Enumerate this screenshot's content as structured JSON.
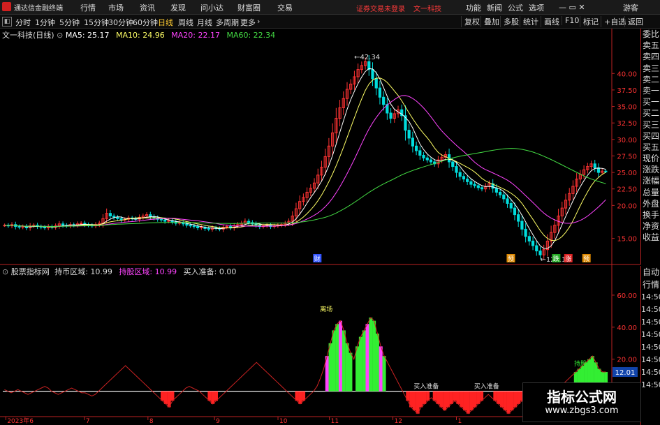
{
  "app": {
    "title": "通达信金融终端"
  },
  "menu": {
    "items": [
      "行情",
      "市场",
      "资讯",
      "发现",
      "问小达",
      "财富圈",
      "交易"
    ],
    "notice": "证券交易未登录",
    "stock_tab": "文一科技",
    "right": [
      "功能",
      "新闻",
      "公式",
      "选项"
    ],
    "user": "游客"
  },
  "periods": {
    "items": [
      "分时",
      "1分钟",
      "5分钟",
      "15分钟",
      "30分钟",
      "60分钟",
      "日线",
      "周线",
      "月线",
      "多周期",
      "更多"
    ],
    "active": "日线"
  },
  "tools": {
    "items": [
      "复权",
      "叠加",
      "多股",
      "统计",
      "画线",
      "F10",
      "标记",
      "+自选",
      "返回"
    ]
  },
  "main_legend": {
    "title": "文一科技(日线)",
    "ma5": "MA5: 25.17",
    "ma10": "MA10: 24.96",
    "ma20": "MA20: 22.17",
    "ma60": "MA60: 22.34"
  },
  "ind_legend": {
    "name": "股票指标网",
    "hold": "持币区域: 10.99",
    "hold_stock": "持股区域: 10.99",
    "buy": "买入准备: 0.00"
  },
  "colors": {
    "ma5": "#ffffff",
    "ma10": "#ffff66",
    "ma20": "#ff44ff",
    "ma60": "#44dd44",
    "up": "#ff3333",
    "down": "#00dddd"
  },
  "right_panel": {
    "top": [
      "委比",
      "卖五",
      "卖四",
      "卖三",
      "卖二",
      "卖一",
      "买一",
      "买二",
      "买三",
      "买四",
      "买五",
      "现价",
      "涨跌",
      "涨幅",
      "总量",
      "外盘",
      "换手",
      "净资",
      "收益"
    ],
    "bottom": [
      "自动",
      "行情",
      "14:50",
      "14:50",
      "14:50",
      "14:50",
      "14:50",
      "14:50",
      "14:50",
      "14:50"
    ]
  },
  "watermark": {
    "title": "指标公式网",
    "url": "www.zbgs3.com"
  },
  "chart_data": [
    {
      "type": "candlestick",
      "title": "文一科技(日线)",
      "y_ticks": [
        "40.00",
        "37.50",
        "35.00",
        "32.50",
        "30.00",
        "27.50",
        "25.00",
        "22.50",
        "20.00",
        "15.00"
      ],
      "ylim": [
        12,
        45
      ],
      "annotations": {
        "high": "42.34",
        "low": "12.11"
      },
      "markers": [
        "财",
        "预",
        "跌",
        "涨",
        "预"
      ],
      "x_ticks": [
        "2023年6",
        "7",
        "8",
        "9",
        "10",
        "11",
        "12",
        "1"
      ],
      "closes": [
        17.0,
        16.9,
        17.1,
        16.8,
        16.7,
        16.8,
        16.6,
        16.9,
        17.0,
        16.8,
        16.7,
        16.6,
        16.8,
        16.7,
        16.9,
        17.2,
        17.0,
        16.9,
        17.1,
        17.0,
        17.2,
        17.3,
        17.1,
        17.0,
        16.9,
        17.1,
        17.3,
        18.0,
        18.8,
        18.4,
        18.2,
        18.0,
        17.8,
        17.9,
        18.1,
        18.0,
        17.9,
        18.2,
        18.4,
        18.6,
        18.3,
        18.1,
        17.9,
        17.8,
        17.6,
        17.7,
        17.5,
        17.3,
        17.4,
        17.2,
        17.0,
        16.9,
        16.8,
        16.6,
        16.7,
        16.5,
        16.4,
        16.6,
        16.5,
        16.4,
        16.7,
        16.8,
        16.6,
        16.9,
        17.1,
        17.3,
        17.6,
        17.4,
        17.2,
        17.0,
        16.8,
        16.9,
        17.0,
        16.8,
        16.9,
        17.0,
        17.1,
        17.3,
        17.6,
        18.4,
        19.5,
        20.6,
        21.2,
        22.0,
        22.6,
        23.4,
        24.6,
        25.8,
        27.4,
        29.0,
        31.0,
        33.2,
        34.8,
        36.2,
        37.6,
        38.4,
        39.5,
        40.6,
        41.2,
        41.8,
        40.6,
        39.2,
        37.8,
        36.4,
        35.3,
        34.0,
        33.2,
        33.9,
        34.5,
        33.6,
        31.4,
        30.2,
        29.0,
        28.3,
        27.6,
        27.2,
        26.9,
        26.6,
        26.3,
        26.9,
        27.3,
        27.7,
        26.6,
        25.9,
        25.0,
        24.4,
        24.0,
        23.6,
        23.2,
        23.0,
        22.7,
        22.5,
        22.9,
        23.3,
        22.6,
        22.0,
        21.6,
        21.0,
        20.3,
        19.6,
        18.6,
        17.6,
        16.4,
        15.3,
        14.6,
        13.9,
        13.1,
        12.5,
        13.3,
        14.6,
        15.9,
        17.0,
        18.4,
        19.6,
        20.8,
        21.8,
        22.9,
        24.0,
        24.7,
        25.4,
        25.9,
        26.3,
        25.7,
        25.0,
        25.2,
        25.17
      ]
    },
    {
      "type": "line",
      "title": "股票指标网",
      "y_ticks": [
        "60.00",
        "40.00",
        "20.00",
        "0.00"
      ],
      "ylim": [
        -15,
        70
      ],
      "current": "12.01",
      "labels": {
        "dead": "离场",
        "buy": "买入准备",
        "hold": "持股"
      },
      "values": [
        1,
        0,
        -1,
        0,
        1,
        0,
        -1,
        -2,
        -1,
        0,
        1,
        2,
        3,
        2,
        0,
        -1,
        -2,
        -1,
        0,
        1,
        2,
        1,
        0,
        -1,
        -1,
        -2,
        -3,
        -2,
        0,
        2,
        4,
        6,
        8,
        10,
        12,
        14,
        16,
        14,
        12,
        10,
        8,
        6,
        4,
        2,
        0,
        -2,
        -4,
        -6,
        -8,
        -10,
        -6,
        -4,
        -2,
        0,
        2,
        3,
        2,
        1,
        0,
        -2,
        -4,
        -6,
        -8,
        -6,
        -4,
        -2,
        0,
        2,
        4,
        6,
        8,
        10,
        12,
        14,
        16,
        18,
        16,
        14,
        12,
        10,
        8,
        6,
        4,
        2,
        0,
        -2,
        -4,
        -6,
        -8,
        -6,
        -4,
        -2,
        0,
        3,
        8,
        14,
        22,
        30,
        38,
        42,
        44,
        38,
        30,
        24,
        20,
        28,
        34,
        38,
        42,
        46,
        44,
        36,
        28,
        22,
        18,
        14,
        10,
        6,
        2,
        -2,
        -6,
        -10,
        -12,
        -14,
        -10,
        -8,
        -6,
        -4,
        -6,
        -8,
        -10,
        -12,
        -10,
        -8,
        -6,
        -8,
        -10,
        -12,
        -14,
        -12,
        -10,
        -8,
        -6,
        -4,
        -2,
        -4,
        -6,
        -8,
        -10,
        -12,
        -14,
        -12,
        -10,
        -8,
        -6,
        -8,
        -10,
        -12,
        -12,
        -10,
        -8,
        -6,
        -4,
        -2,
        0,
        2,
        4,
        6,
        8,
        10,
        12,
        14,
        16,
        18,
        20,
        22,
        18,
        14,
        12,
        12.01
      ]
    }
  ]
}
